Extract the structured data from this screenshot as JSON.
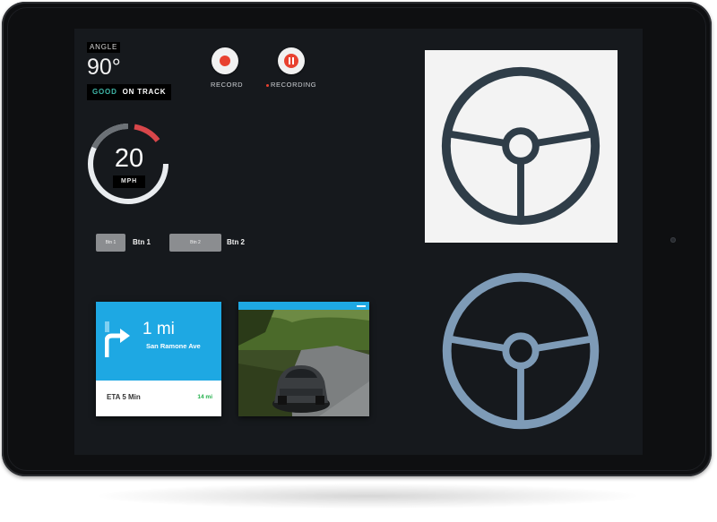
{
  "colors": {
    "accent_blue": "#1ea8e3",
    "record_red": "#e8412f",
    "good_teal": "#3fb6a8",
    "eta_green": "#22b04b",
    "wheel_dark": "#2f3d48",
    "wheel_light": "#7e9bb7",
    "screen_bg": "#16191d"
  },
  "angle": {
    "label": "ANGLE",
    "value": "90°",
    "status_good": "GOOD",
    "status_text": "ON TRACK"
  },
  "speed": {
    "value": "20",
    "unit": "MPH"
  },
  "controls": {
    "record_label": "RECORD",
    "recording_label": "RECORDING",
    "record_icon": "record-icon",
    "pause_icon": "pause-icon"
  },
  "buttons": [
    {
      "inner": "Btn 1",
      "label": "Btn 1"
    },
    {
      "inner": "Btn 2",
      "label": "Btn 2"
    }
  ],
  "navigation": {
    "distance": "1 mi",
    "street": "San Ramone Ave",
    "eta": "ETA 5 Min",
    "remaining": "14 mi",
    "turn_icon": "turn-right-arrow-icon"
  },
  "steering": {
    "icon": "steering-wheel-icon"
  }
}
